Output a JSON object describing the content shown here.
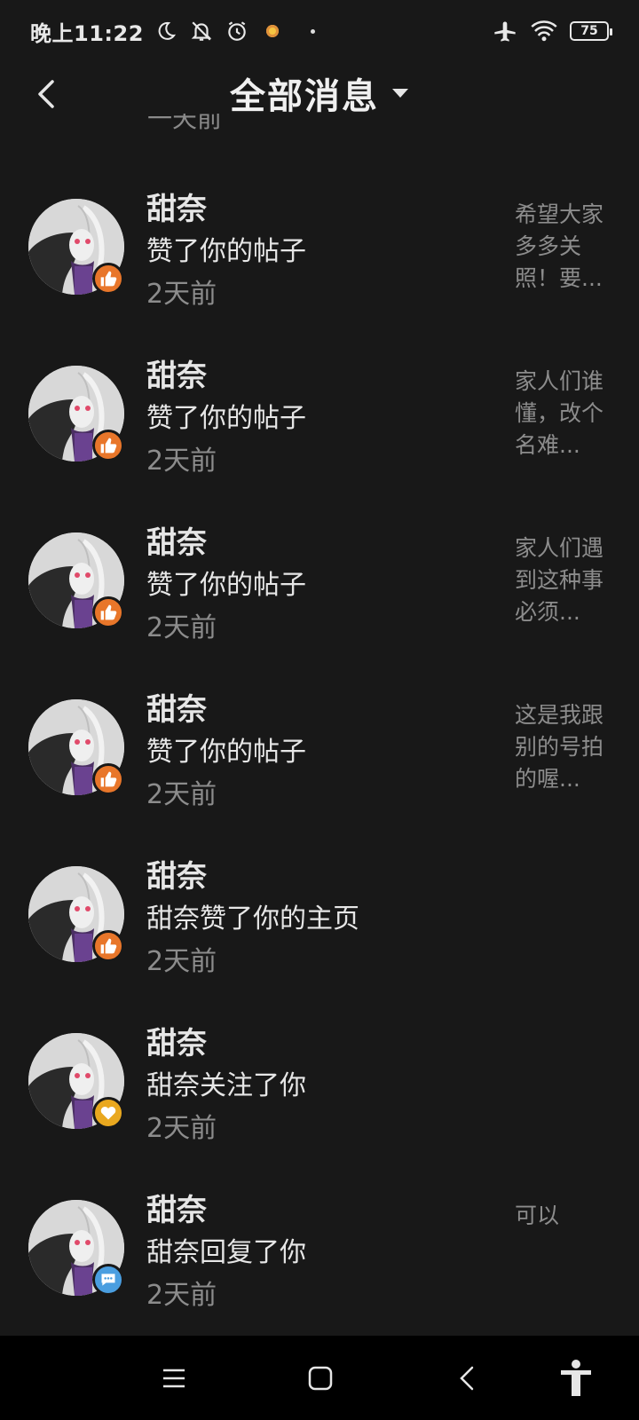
{
  "status_bar": {
    "time": "晚上11:22",
    "battery": "75",
    "icons": [
      "moon-icon",
      "bell-off-icon",
      "alarm-icon",
      "flower-icon",
      "dot-icon",
      "airplane-icon",
      "wifi-icon",
      "battery-icon"
    ]
  },
  "header": {
    "title": "全部消息",
    "back_icon": "chevron-left-icon",
    "dropdown_icon": "caret-down-icon"
  },
  "cut_text": "一天前",
  "messages": [
    {
      "name": "甜奈",
      "action": "赞了你的帖子",
      "time": "2天前",
      "preview": "希望大家多多关照！要...",
      "badge": "thumbs-up-icon",
      "badge_color": "#e8762a"
    },
    {
      "name": "甜奈",
      "action": "赞了你的帖子",
      "time": "2天前",
      "preview": "家人们谁懂，改个名难...",
      "badge": "thumbs-up-icon",
      "badge_color": "#e8762a"
    },
    {
      "name": "甜奈",
      "action": "赞了你的帖子",
      "time": "2天前",
      "preview": "家人们遇到这种事必须...",
      "badge": "thumbs-up-icon",
      "badge_color": "#e8762a"
    },
    {
      "name": "甜奈",
      "action": "赞了你的帖子",
      "time": "2天前",
      "preview": "这是我跟别的号拍的喔...",
      "badge": "thumbs-up-icon",
      "badge_color": "#e8762a"
    },
    {
      "name": "甜奈",
      "action": "甜奈赞了你的主页",
      "time": "2天前",
      "preview": "",
      "badge": "thumbs-up-icon",
      "badge_color": "#e8762a"
    },
    {
      "name": "甜奈",
      "action": "甜奈关注了你",
      "time": "2天前",
      "preview": "",
      "badge": "heart-icon",
      "badge_color": "#e9a81f"
    },
    {
      "name": "甜奈",
      "action": "甜奈回复了你",
      "time": "2天前",
      "preview": "可以",
      "badge": "chat-bubble-icon",
      "badge_color": "#4a9ee0"
    }
  ],
  "nav_bar": {
    "buttons": [
      "menu-icon",
      "home-square-icon",
      "back-icon",
      "accessibility-icon"
    ]
  }
}
